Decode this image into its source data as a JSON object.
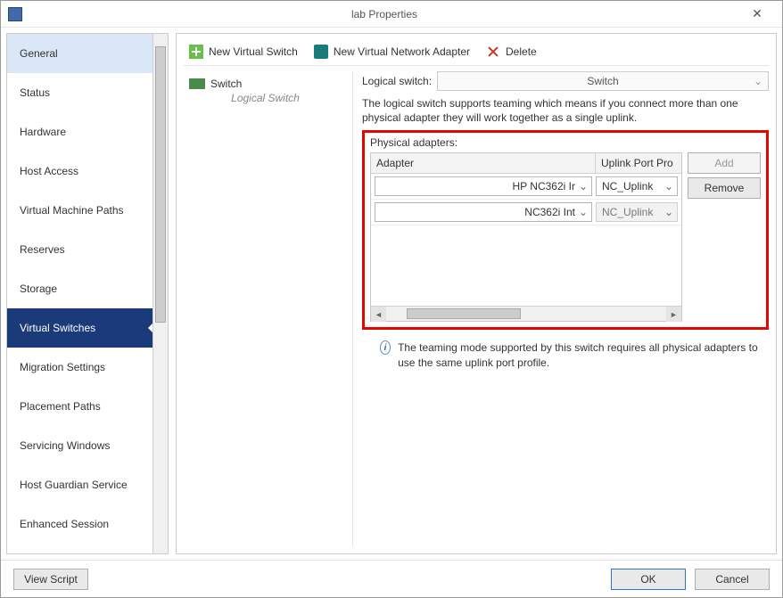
{
  "window": {
    "title": "lab Properties"
  },
  "sidebar": {
    "items": [
      {
        "label": "General"
      },
      {
        "label": "Status"
      },
      {
        "label": "Hardware"
      },
      {
        "label": "Host Access"
      },
      {
        "label": "Virtual Machine Paths"
      },
      {
        "label": "Reserves"
      },
      {
        "label": "Storage"
      },
      {
        "label": "Virtual Switches"
      },
      {
        "label": "Migration Settings"
      },
      {
        "label": "Placement Paths"
      },
      {
        "label": "Servicing Windows"
      },
      {
        "label": "Host Guardian Service"
      },
      {
        "label": "Enhanced Session"
      }
    ]
  },
  "toolbar": {
    "new_switch": "New Virtual Switch",
    "new_adapter": "New Virtual Network Adapter",
    "delete": "Delete"
  },
  "switchlist": {
    "entry": {
      "name": "Switch",
      "subtitle": "Logical Switch"
    }
  },
  "right": {
    "logical_label": "Logical switch:",
    "logical_value": "Switch",
    "description": "The logical switch supports teaming which means if you connect more than one physical adapter they will work together as a single uplink.",
    "phys_label": "Physical adapters:",
    "columns": {
      "adapter": "Adapter",
      "upp": "Uplink Port Pro"
    },
    "rows": [
      {
        "adapter": "HP NC362i Ir",
        "upp": "NC_Uplink",
        "upp_disabled": false
      },
      {
        "adapter": "NC362i Int",
        "upp": "NC_Uplink",
        "upp_disabled": true
      }
    ],
    "buttons": {
      "add": "Add",
      "remove": "Remove"
    },
    "info": "The teaming mode supported by this switch requires all physical adapters to use the same uplink port profile."
  },
  "footer": {
    "view_script": "View Script",
    "ok": "OK",
    "cancel": "Cancel"
  }
}
